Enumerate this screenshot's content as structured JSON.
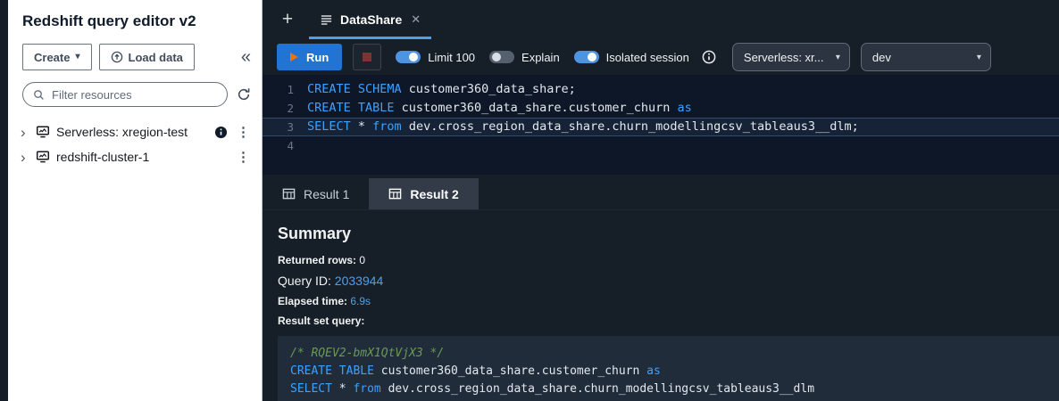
{
  "colors": {
    "accent_blue": "#539fe5",
    "keyword_blue": "#3da1ff",
    "comment_green": "#6a9955",
    "play_orange": "#ec7211"
  },
  "sidebar": {
    "title": "Redshift query editor v2",
    "create_button": "Create",
    "load_data_button": "Load data",
    "filter_placeholder": "Filter resources",
    "tree": [
      {
        "label": "Serverless: xregion-test"
      },
      {
        "label": "redshift-cluster-1"
      }
    ]
  },
  "tabbar": {
    "tab_label": "DataShare"
  },
  "toolbar": {
    "run_label": "Run",
    "toggles": [
      {
        "label": "Limit 100",
        "on": true
      },
      {
        "label": "Explain",
        "on": false
      },
      {
        "label": "Isolated session",
        "on": true
      }
    ],
    "selects": [
      {
        "value": "Serverless: xr..."
      },
      {
        "value": "dev"
      }
    ]
  },
  "editor": {
    "lines": [
      {
        "n": "1",
        "active": false,
        "tokens": [
          {
            "c": "kw",
            "t": "CREATE SCHEMA"
          },
          {
            "c": "id",
            "t": " customer360_data_share;"
          }
        ]
      },
      {
        "n": "2",
        "active": false,
        "tokens": [
          {
            "c": "kw",
            "t": "CREATE TABLE"
          },
          {
            "c": "id",
            "t": " customer360_data_share.customer_churn "
          },
          {
            "c": "kw",
            "t": "as"
          }
        ]
      },
      {
        "n": "3",
        "active": true,
        "tokens": [
          {
            "c": "kw",
            "t": "SELECT"
          },
          {
            "c": "id",
            "t": " * "
          },
          {
            "c": "kw",
            "t": "from"
          },
          {
            "c": "id",
            "t": " dev.cross_region_data_share.churn_modellingcsv_tableaus3__dlm;"
          }
        ]
      },
      {
        "n": "4",
        "active": false,
        "tokens": []
      }
    ]
  },
  "results": {
    "tabs": [
      {
        "label": "Result 1",
        "active": false
      },
      {
        "label": "Result 2",
        "active": true
      }
    ],
    "summary_title": "Summary",
    "returned_rows_label": "Returned rows:",
    "returned_rows_value": "0",
    "query_id_label": "Query ID:",
    "query_id_value": "2033944",
    "elapsed_label": "Elapsed time:",
    "elapsed_value": "6.9s",
    "result_set_query_label": "Result set query:",
    "query_block": [
      {
        "tokens": [
          {
            "c": "cm",
            "t": "/* RQEV2-bmX1QtVjX3 */"
          }
        ]
      },
      {
        "tokens": [
          {
            "c": "kw",
            "t": "CREATE TABLE"
          },
          {
            "c": "id",
            "t": " customer360_data_share.customer_churn "
          },
          {
            "c": "kw",
            "t": "as"
          }
        ]
      },
      {
        "tokens": [
          {
            "c": "kw",
            "t": "SELECT"
          },
          {
            "c": "id",
            "t": " * "
          },
          {
            "c": "kw",
            "t": "from"
          },
          {
            "c": "id",
            "t": " dev.cross_region_data_share.churn_modellingcsv_tableaus3__dlm"
          }
        ]
      }
    ]
  }
}
